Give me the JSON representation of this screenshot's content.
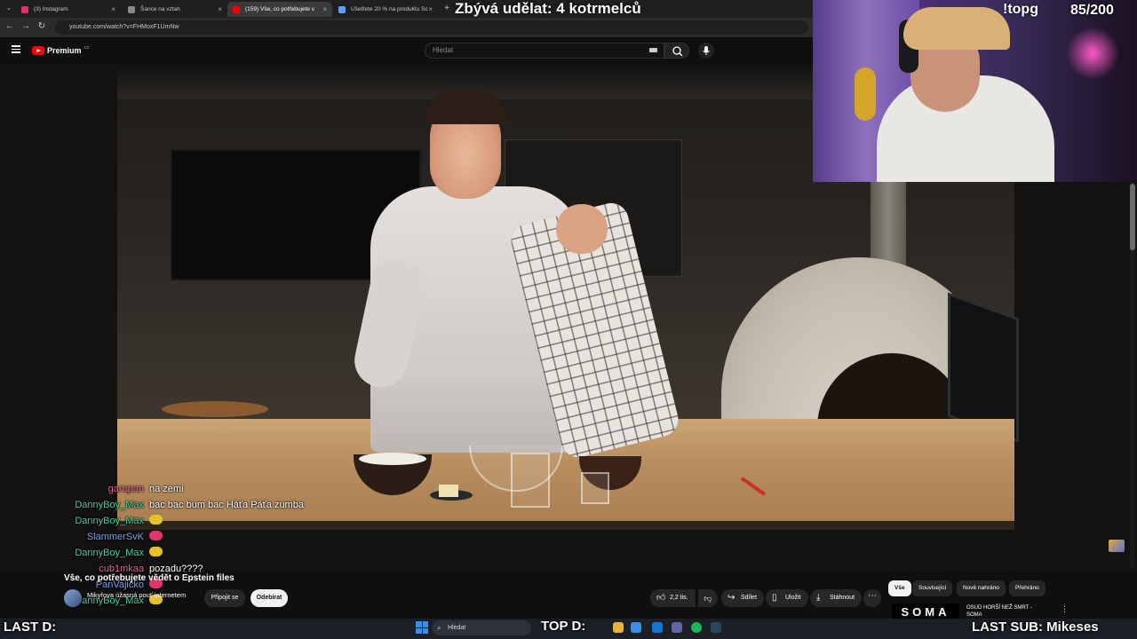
{
  "browser": {
    "tabs": [
      {
        "label": "(3) Instagram",
        "fav_color": "#e1306c",
        "active": false
      },
      {
        "label": "Šance na vztah",
        "fav_color": "#8a8a8a",
        "active": false
      },
      {
        "label": "(159) Vše, co potřebujete v",
        "fav_color": "#ff0000",
        "active": true
      },
      {
        "label": "Ušetřete 20 % na produktu Sc",
        "fav_color": "#5aa0ff",
        "active": false
      }
    ],
    "url": "youtube.com/watch?v=FHMoxF1UmNw"
  },
  "youtube": {
    "brand": "Premium",
    "country": "CZ",
    "search_placeholder": "Hledat",
    "video_title": "Vše, co potřebujete vědět o Epstein files",
    "channel_name": "Mikyřova úžasná pouť internetem",
    "join_label": "Připojit se",
    "subscribe_label": "Odebírat",
    "actions": {
      "likes": "2,2 tis.",
      "share": "Sdílet",
      "save": "Uložit",
      "download": "Stáhnout"
    },
    "chips": [
      "Vše",
      "Související",
      "Nově nahráno",
      "Přehráno"
    ],
    "recommended": {
      "thumb_text": "SOMA",
      "title_line1": "OSUD HORŠÍ NEŽ SMRT -",
      "title_line2": "SOMA"
    }
  },
  "stream": {
    "remaining": "Zbývá udělat: 4 kotrmelců",
    "command": "!topg",
    "counter": "85/200",
    "last_d": "LAST D:",
    "top_d": "TOP D:",
    "last_sub": "LAST SUB: Mikeses"
  },
  "chat": [
    {
      "user": "garapan",
      "color": "#d96a8c",
      "text": "na zemi",
      "emote": null
    },
    {
      "user": "DannyBoy_Max",
      "color": "#3bd1a0",
      "text": "bac bac bum bac Háťa Páťa zumba",
      "emote": null
    },
    {
      "user": "DannyBoy_Max",
      "color": "#3bd1a0",
      "text": "",
      "emote": "#e6c229"
    },
    {
      "user": "SlammerSvK",
      "color": "#7aa0e8",
      "text": "",
      "emote": "#e3336b"
    },
    {
      "user": "DannyBoy_Max",
      "color": "#3bd1a0",
      "text": "",
      "emote": "#e6c229"
    },
    {
      "user": "cub1mkaa",
      "color": "#d96a8c",
      "text": "pozadu????",
      "emote": null
    },
    {
      "user": "PanVajicko",
      "color": "#7aa0e8",
      "text": "",
      "emote": "#e3336b"
    },
    {
      "user": "DannyBoy_Max",
      "color": "#3bd1a0",
      "text": "",
      "emote": "#e6c229"
    }
  ],
  "taskbar": {
    "search_label": "Hledat"
  }
}
